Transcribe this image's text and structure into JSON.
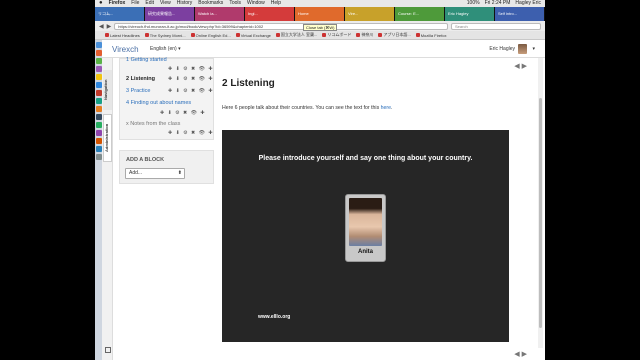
{
  "menubar": {
    "apple": "",
    "items": [
      "Firefox",
      "File",
      "Edit",
      "View",
      "History",
      "Bookmarks",
      "Tools",
      "Window",
      "Help"
    ],
    "status": [
      "100%",
      "Fri 2:24 PM",
      "Hagley Eric"
    ]
  },
  "tabs": [
    "リコム...",
    "研究成果報告...",
    "Watch la...",
    "Ingl...",
    "Home",
    "Vire...",
    "Course: E...",
    "Eric Hagley",
    "Self intro..."
  ],
  "urlbar": {
    "back": "◀",
    "forward": "▶",
    "url": "https://vireoch.fhd.muroran-it.ac.jp/mod/book/view.php?id=36599&chapterid=1002",
    "search_placeholder": "Search",
    "tooltip": "Close tab (⌘W)"
  },
  "bookmarks": [
    "Latest Headlines",
    "The Sydney Morni...",
    "Online English Ed...",
    "Virtual Exchange",
    "国立大学法人 室蘭...",
    "リコムボード",
    "神奈川",
    "アプリ日本語...",
    "Mozilla Firefox"
  ],
  "header": {
    "logo": "Virexch",
    "language": "English (en)",
    "caret": "▾",
    "username": "Eric Hagley"
  },
  "drawer": {
    "tab1": "Navigation",
    "tab2": "Administration"
  },
  "book_nav": {
    "item1": "1 Getting started",
    "item2": "2 Listening",
    "item3": "3 Practice",
    "item4": "4 Finding out about names",
    "item5": "x Notes from the class",
    "edit_icons": "✚ ⬇ ⚙ ✖ 👁 ✚"
  },
  "add_block": {
    "title": "ADD A BLOCK",
    "select_value": "Add...",
    "select_arrow": "⬍"
  },
  "main": {
    "title": "2 Listening",
    "intro": "Here 6 people talk about their countries. You can see the text for this ",
    "intro_link": "here",
    "intro_end": ".",
    "nav_prev": "◀",
    "nav_next": "▶"
  },
  "video": {
    "prompt": "Please introduce yourself and say one thing about your country.",
    "person_name": "Anita",
    "footer": "www.elllo.org"
  },
  "colors": {
    "link": "#2a6ebb",
    "video_bg": "#262626",
    "panel_bg": "#f3f3f3"
  }
}
